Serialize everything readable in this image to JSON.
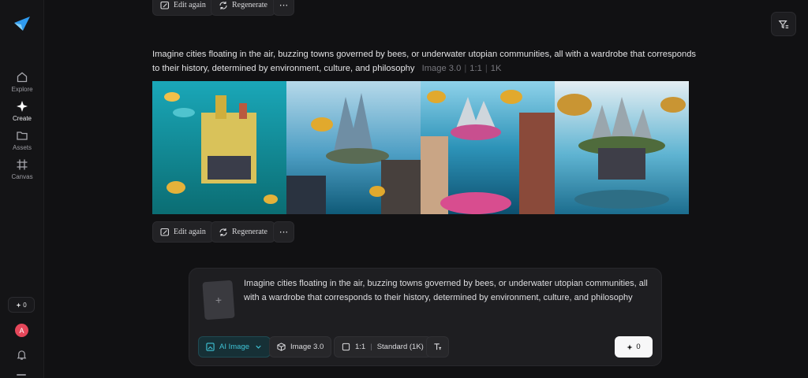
{
  "sidebar": {
    "nav": [
      {
        "label": "Explore",
        "icon": "home-icon"
      },
      {
        "label": "Create",
        "icon": "sparkle-icon"
      },
      {
        "label": "Assets",
        "icon": "folder-icon"
      },
      {
        "label": "Canvas",
        "icon": "canvas-icon"
      }
    ],
    "credits": "0",
    "avatar_initial": "A"
  },
  "top_actions": {
    "edit_label": "Edit again",
    "regenerate_label": "Regenerate"
  },
  "generation": {
    "prompt": "Imagine cities floating in the air, buzzing towns governed by bees, or underwater utopian communities, all with a wardrobe that corresponds to their history, determined by environment, culture, and philosophy",
    "model": "Image 3.0",
    "ratio": "1:1",
    "resolution": "1K",
    "edit_label": "Edit again",
    "regenerate_label": "Regenerate"
  },
  "composer": {
    "prompt": "Imagine cities floating in the air, buzzing towns governed by bees, or underwater utopian communities, all with a wardrobe that corresponds to their history, determined by environment, culture, and philosophy",
    "mode": "AI Image",
    "model": "Image 3.0",
    "ratio": "1:1",
    "quality": "Standard (1K)",
    "generate_cost": "0"
  },
  "colors": {
    "accent_teal": "#3fc3d6",
    "avatar": "#e5475a",
    "logo_blue": "#2f9bf0"
  }
}
